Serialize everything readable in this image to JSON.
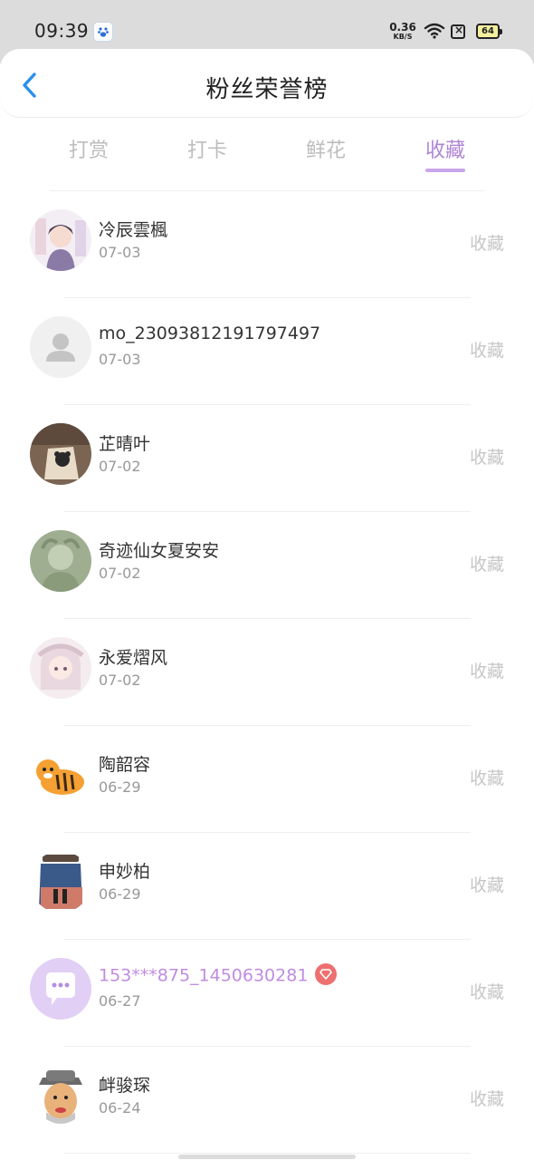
{
  "status_bar": {
    "time": "09:39",
    "net_speed_value": "0.36",
    "net_speed_unit": "KB/S",
    "battery": "64",
    "icons": [
      "baidu-app-icon",
      "wifi-icon",
      "sim-icon",
      "battery-icon"
    ]
  },
  "header": {
    "title": "粉丝荣誉榜",
    "back_icon": "chevron-left-icon"
  },
  "tabs": [
    {
      "label": "打赏",
      "active": false
    },
    {
      "label": "打卡",
      "active": false
    },
    {
      "label": "鲜花",
      "active": false
    },
    {
      "label": "收藏",
      "active": true
    }
  ],
  "colors": {
    "accent": "#b085d6",
    "vip_badge": "#ee6f6f"
  },
  "fans": [
    {
      "name": "冷辰雲楓",
      "date": "07-03",
      "action": "收藏",
      "vip": false
    },
    {
      "name": "mo_23093812191797497",
      "date": "07-03",
      "action": "收藏",
      "vip": false
    },
    {
      "name": "芷晴叶",
      "date": "07-02",
      "action": "收藏",
      "vip": false
    },
    {
      "name": "奇迹仙女夏安安",
      "date": "07-02",
      "action": "收藏",
      "vip": false
    },
    {
      "name": "永爱熠风",
      "date": "07-02",
      "action": "收藏",
      "vip": false
    },
    {
      "name": "陶韶容",
      "date": "06-29",
      "action": "收藏",
      "vip": false
    },
    {
      "name": "申妙柏",
      "date": "06-29",
      "action": "收藏",
      "vip": false
    },
    {
      "name": "153***875_1450630281",
      "date": "06-27",
      "action": "收藏",
      "vip": true
    },
    {
      "name": "衅骏琛",
      "date": "06-24",
      "action": "收藏",
      "vip": false
    }
  ]
}
